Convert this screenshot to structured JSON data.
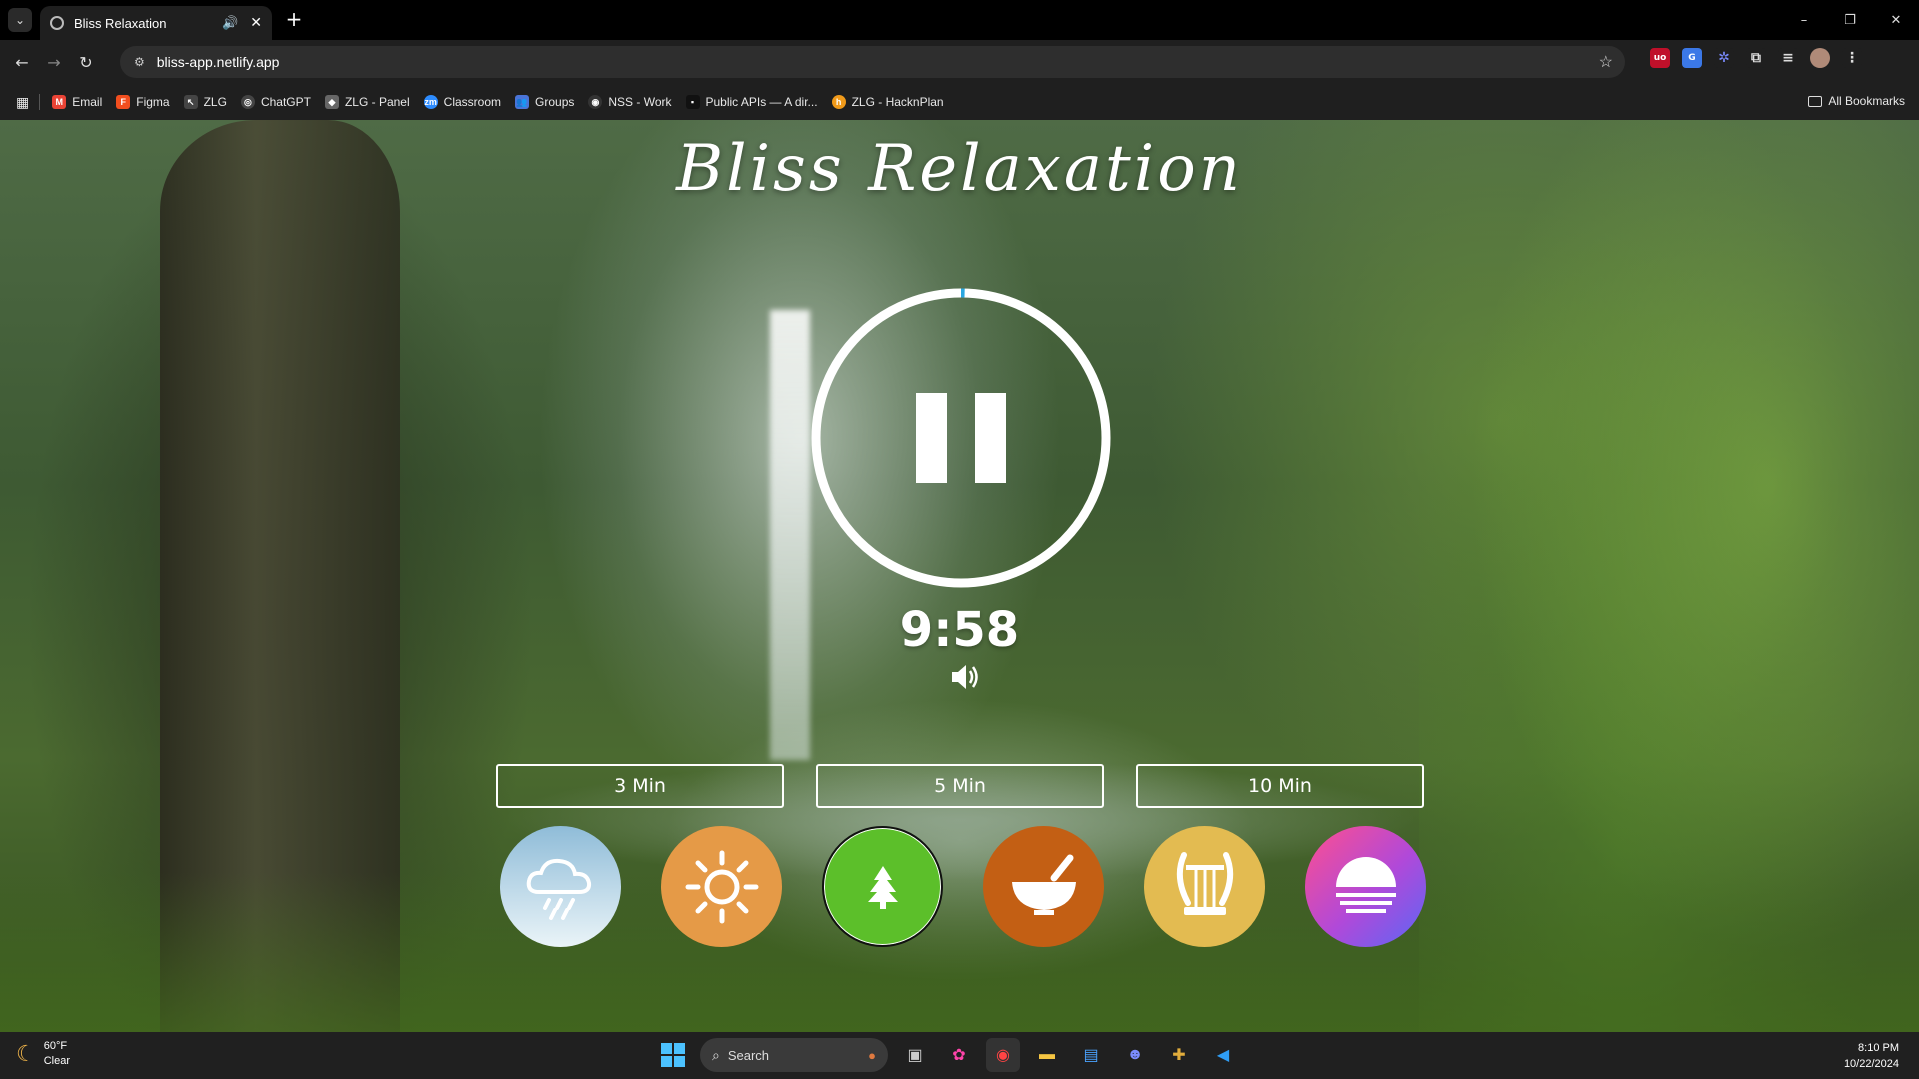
{
  "browser": {
    "tab": {
      "title": "Bliss Relaxation",
      "audio_icon": "speaker-icon",
      "close_label": "✕"
    },
    "new_tab_label": "+",
    "window_controls": [
      "–",
      "❐",
      "✕"
    ],
    "address": "bliss-app.netlify.app",
    "bookmarks": [
      {
        "label": "Email",
        "icon": "gmail-icon",
        "color": "#ea4335"
      },
      {
        "label": "Figma",
        "icon": "figma-icon",
        "color": "#f24e1e"
      },
      {
        "label": "ZLG",
        "icon": "cursor-icon",
        "color": "#444444"
      },
      {
        "label": "ChatGPT",
        "icon": "chatgpt-icon",
        "color": "#444444"
      },
      {
        "label": "ZLG - Panel",
        "icon": "panel-icon",
        "color": "#666666"
      },
      {
        "label": "Classroom",
        "icon": "zoom-icon",
        "color": "#2d8cff"
      },
      {
        "label": "Groups",
        "icon": "groups-icon",
        "color": "#4a74d8"
      },
      {
        "label": "NSS - Work",
        "icon": "github-icon",
        "color": "#333333"
      },
      {
        "label": "Public APIs — A dir...",
        "icon": "api-icon",
        "color": "#111111"
      },
      {
        "label": "ZLG - HacknPlan",
        "icon": "hacknplan-icon",
        "color": "#f09a1a"
      }
    ],
    "all_bookmarks": "All Bookmarks"
  },
  "app": {
    "title": "Bliss Relaxation",
    "time_remaining": "9:58",
    "progress_fraction": 0.003,
    "durations": [
      "3 Min",
      "5 Min",
      "10 Min"
    ],
    "sounds": [
      {
        "name": "rain",
        "icon": "rain-cloud-icon"
      },
      {
        "name": "sun",
        "icon": "sun-icon"
      },
      {
        "name": "forest",
        "icon": "tree-icon",
        "selected": true
      },
      {
        "name": "bowl",
        "icon": "singing-bowl-icon"
      },
      {
        "name": "harp",
        "icon": "lyre-icon"
      },
      {
        "name": "sunset",
        "icon": "sunset-icon"
      }
    ]
  },
  "taskbar": {
    "temperature": "60°F",
    "condition": "Clear",
    "search_placeholder": "Search",
    "time": "8:10 PM",
    "date": "10/22/2024"
  }
}
